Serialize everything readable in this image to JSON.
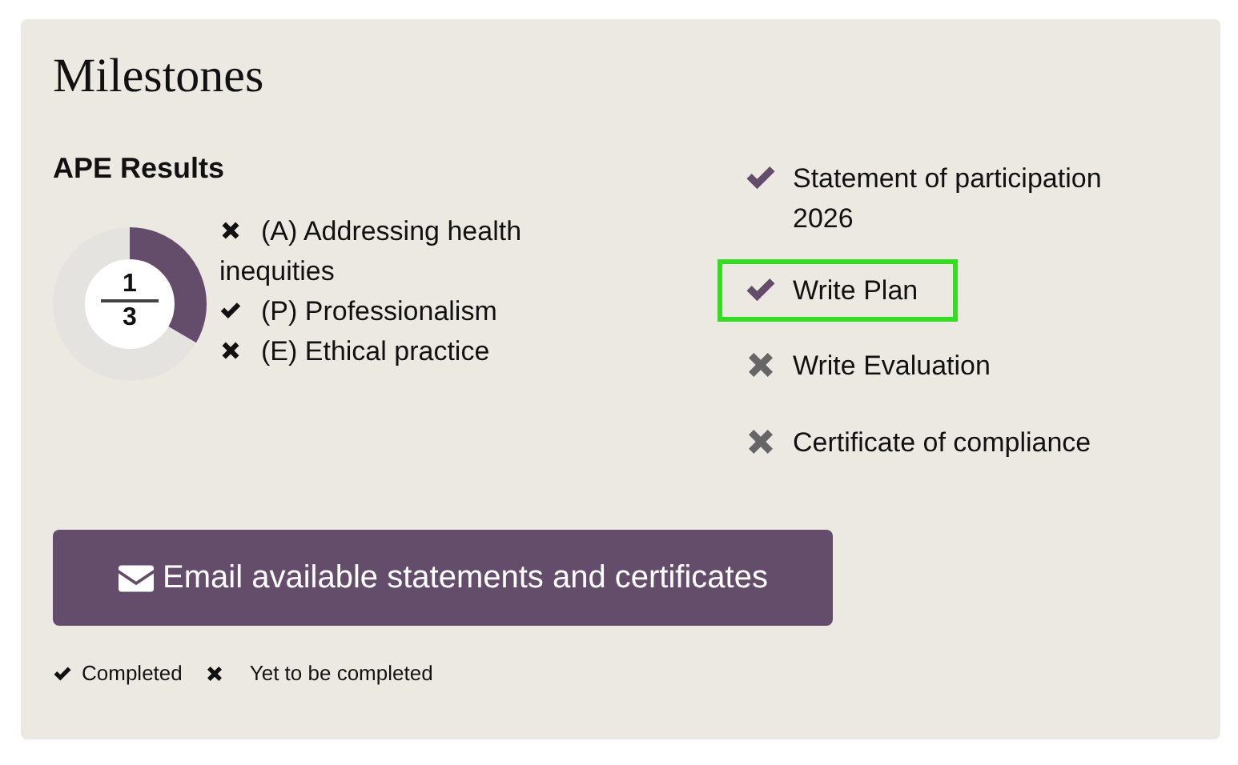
{
  "title": "Milestones",
  "ape": {
    "heading": "APE Results",
    "donut": {
      "numerator": "1",
      "denominator": "3",
      "level": 0.3333
    },
    "items": [
      {
        "label": "(A) Addressing health inequities",
        "done": false
      },
      {
        "label": "(P) Professionalism",
        "done": true
      },
      {
        "label": "(E) Ethical practice",
        "done": false
      }
    ]
  },
  "milestones": [
    {
      "label": "Statement of participation 2026",
      "done": true,
      "highlighted": false
    },
    {
      "label": "Write Plan",
      "done": true,
      "highlighted": true
    },
    {
      "label": "Write Evaluation",
      "done": false,
      "highlighted": false
    },
    {
      "label": "Certificate of compliance",
      "done": false,
      "highlighted": false
    }
  ],
  "email_button": "Email available statements and certificates",
  "legend": [
    {
      "label": "Completed",
      "done": true
    },
    {
      "label": "Yet to be completed",
      "done": false
    }
  ]
}
